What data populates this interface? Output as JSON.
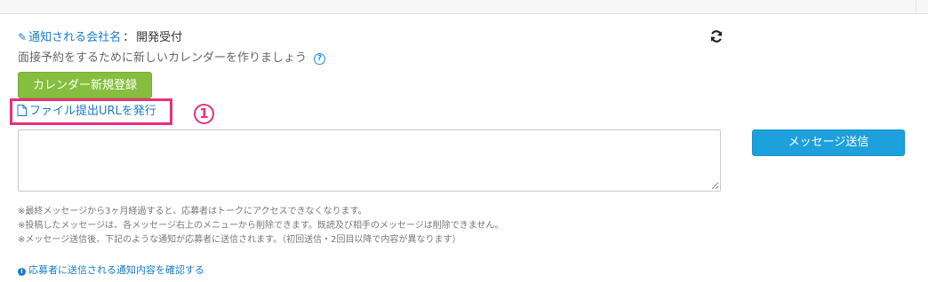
{
  "notification": {
    "label": "通知される会社名",
    "separator": "：",
    "company_name": "開発受付"
  },
  "calendar": {
    "hint": "面接予約をするために新しいカレンダーを作りましょう",
    "register_button": "カレンダー新規登録"
  },
  "file": {
    "issue_link": "ファイル提出URLを発行"
  },
  "annotation": {
    "step_marker": "①",
    "color": "#e8317a"
  },
  "message": {
    "textarea_value": "",
    "send_button": "メッセージ送信"
  },
  "notes": [
    "※最終メッセージから3ヶ月経過すると、応募者はトークにアクセスできなくなります。",
    "※投稿したメッセージは、各メッセージ右上のメニューから削除できます。既読及び相手のメッセージは削除できません。",
    "※メッセージ送信後、下記のような通知が応募者に送信されます。（初回送信・2回目以降で内容が異なります）"
  ],
  "confirm_link": "応募者に送信される通知内容を確認する",
  "icons": {
    "pencil": "pencil-icon",
    "refresh": "refresh-icon",
    "help": "question-circle-icon",
    "document": "document-icon",
    "info": "info-circle-icon"
  },
  "colors": {
    "link": "#1a7cc9",
    "green_button": "#86bf40",
    "blue_button": "#1ea0dc",
    "highlight": "#e8317a"
  }
}
